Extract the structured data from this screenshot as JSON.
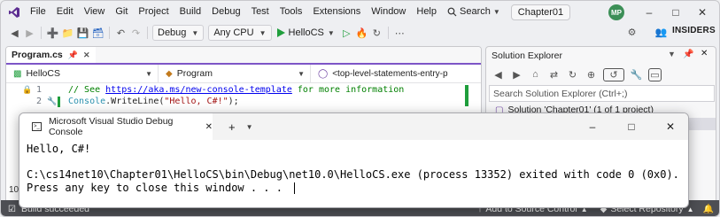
{
  "menu": {
    "items": [
      "File",
      "Edit",
      "View",
      "Git",
      "Project",
      "Build",
      "Debug",
      "Test",
      "Tools",
      "Extensions",
      "Window",
      "Help"
    ],
    "search_label": "Search",
    "solution_name": "Chapter01",
    "avatar_initials": "MP"
  },
  "toolbar": {
    "configuration": "Debug",
    "platform": "Any CPU",
    "run_target": "HelloCS",
    "insiders_label": "INSIDERS"
  },
  "editor": {
    "tab_name": "Program.cs",
    "nav_project": "HelloCS",
    "nav_class": "Program",
    "nav_member": "<top-level-statements-entry-p",
    "line_numbers": [
      "1",
      "2"
    ],
    "line1": {
      "prefix": "// See ",
      "link": "https://aka.ms/new-console-template",
      "suffix": " for more information"
    },
    "line2": {
      "type": "Console",
      "method": ".WriteLine(",
      "string": "\"Hello, C#!\"",
      "end": ");"
    },
    "partial_line_number": "10"
  },
  "solution_explorer": {
    "title": "Solution Explorer",
    "search_placeholder": "Search Solution Explorer (Ctrl+;)",
    "solution_label": "Solution 'Chapter01' (1 of 1 project)"
  },
  "console": {
    "title": "Microsoft Visual Studio Debug Console",
    "output": "Hello, C#!\n\nC:\\cs14net10\\Chapter01\\HelloCS\\bin\\Debug\\net10.0\\HelloCS.exe (process 13352) exited with code 0 (0x0).\nPress any key to close this window . . ."
  },
  "statusbar": {
    "build_status": "Build succeeded",
    "source_control": "Add to Source Control",
    "repository": "Select Repository"
  },
  "colors": {
    "accent": "#7d55c7",
    "status_bar": "#4e4f54",
    "run_green": "#1f9e3c",
    "comment": "#008000",
    "link": "#0000ee",
    "type": "#2b91af",
    "string": "#a31515"
  }
}
